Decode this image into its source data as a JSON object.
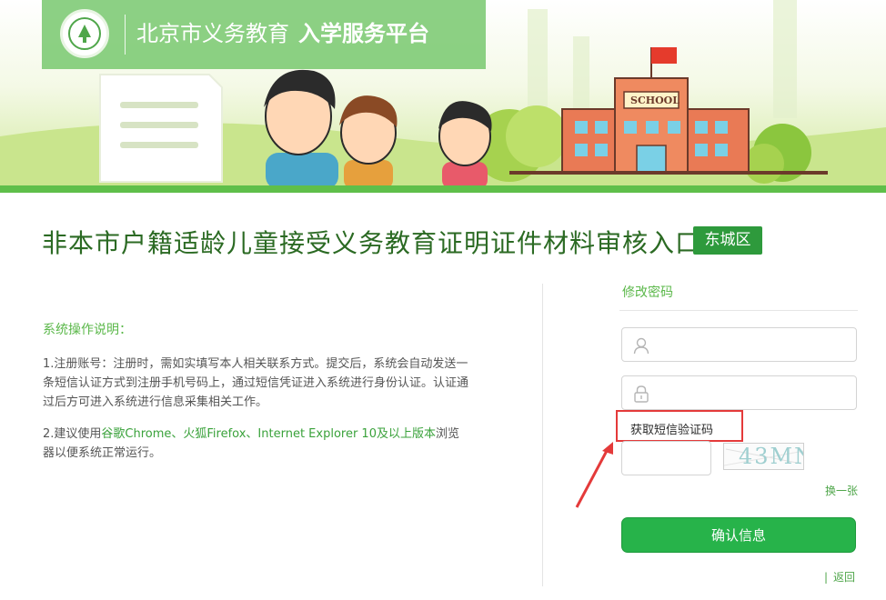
{
  "header": {
    "platform_region": "北京市义务教育",
    "platform_name": "入学服务平台",
    "school_sign": "SCHOOL"
  },
  "page": {
    "title": "非本市户籍适龄儿童接受义务教育证明证件材料审核入口",
    "district": "东城区"
  },
  "instructions": {
    "heading": "系统操作说明：",
    "item1": "1.注册账号：注册时，需如实填写本人相关联系方式。提交后，系统会自动发送一条短信认证方式到注册手机号码上，通过短信凭证进入系统进行身份认证。认证通过后方可进入系统进行信息采集相关工作。",
    "item2_prefix": "2.建议使用",
    "item2_browsers": "谷歌Chrome、火狐Firefox、Internet Explorer 10及以上版本",
    "item2_suffix": "浏览器以便系统正常运行。"
  },
  "form": {
    "heading": "修改密码",
    "username": {
      "value": "",
      "placeholder": ""
    },
    "password": {
      "value": "",
      "placeholder": ""
    },
    "sms_button": "获取短信验证码",
    "captcha_input": {
      "value": "",
      "placeholder": ""
    },
    "captcha_text": "43MN",
    "refresh_label": "换一张",
    "submit_label": "确认信息",
    "back_separator": "|",
    "back_label": "返回"
  },
  "colors": {
    "brand_green": "#2e9a3c",
    "button_green": "#27b34a",
    "title_green": "#2b6a23",
    "annotation_red": "#e43a3a"
  },
  "icons": [
    "logo-emblem",
    "user-icon",
    "lock-icon",
    "annotation-arrow"
  ]
}
